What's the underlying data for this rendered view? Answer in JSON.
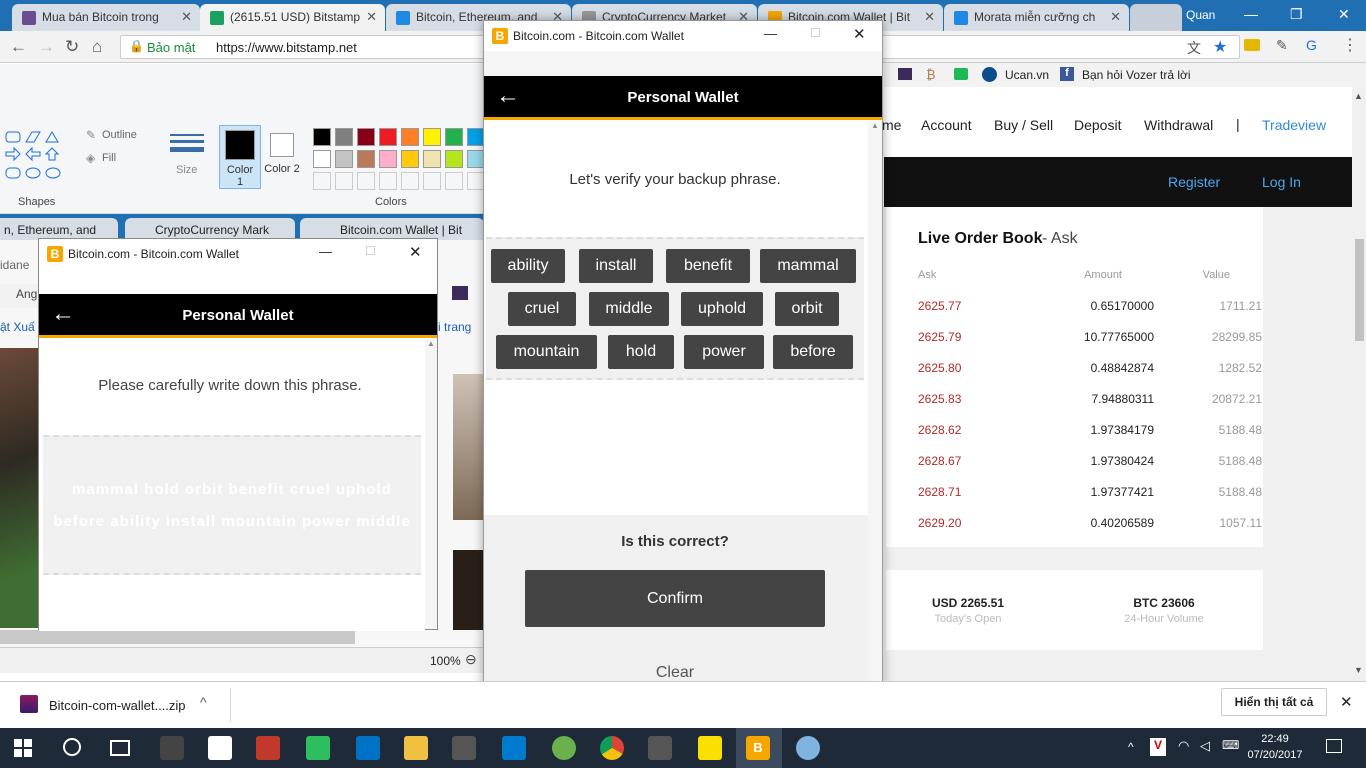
{
  "browser": {
    "tabs": [
      {
        "label": "Mua bán Bitcoin trong",
        "fav": "#6a4c93"
      },
      {
        "label": "(2615.51 USD) Bitstamp",
        "fav": "#1aa260"
      },
      {
        "label": "Bitcoin, Ethereum, and",
        "fav": "#1e88e5"
      },
      {
        "label": "CryptoCurrency Market",
        "fav": "#999999"
      },
      {
        "label": "Bitcoin.com Wallet | Bit",
        "fav": "#f7a600"
      },
      {
        "label": "Morata miễn cưỡng ch",
        "fav": "#1e88e5"
      }
    ],
    "profile": "Quan",
    "secure_label": "Bảo mật",
    "url": "https://www.bitstamp.net",
    "bookmarks": [
      "Ucan.vn",
      "Bạn hỏi Vozer trả lời"
    ]
  },
  "paint": {
    "outline": "Outline",
    "fill": "Fill",
    "shapes": "Shapes",
    "size": "Size",
    "color1": "Color 1",
    "color2": "Color 2",
    "colors": "Colors",
    "zoom": "100%",
    "palette": [
      "#000000",
      "#7f7f7f",
      "#880015",
      "#ed1c24",
      "#ff7f27",
      "#fff200",
      "#22b14c",
      "#00a2e8",
      "#ffffff",
      "#c3c3c3",
      "#b97a57",
      "#ffaec9",
      "#ffc90e",
      "#efe4b0",
      "#b5e61d",
      "#99d9ea"
    ]
  },
  "bg_browser": {
    "tabs": [
      "n, Ethereum, and",
      "CryptoCurrency Mark",
      "Bitcoin.com Wallet | Bit"
    ],
    "left_texts": [
      "idane",
      "Ang",
      "ật Xuấ"
    ],
    "right_text": "i trang"
  },
  "bitstamp": {
    "nav": [
      "me",
      "Account",
      "Buy / Sell",
      "Deposit",
      "Withdrawal",
      "|",
      "Tradeview"
    ],
    "register": "Register",
    "login": "Log In",
    "orderbook_title": "Live Order Book",
    "orderbook_side": "Ask",
    "col_headers": [
      "Ask",
      "Amount",
      "Value"
    ],
    "rows": [
      [
        "2625.77",
        "0.65170000",
        "1711.21"
      ],
      [
        "2625.79",
        "10.77765000",
        "28299.85"
      ],
      [
        "2625.80",
        "0.48842874",
        "1282.52"
      ],
      [
        "2625.83",
        "7.94880311",
        "20872.21"
      ],
      [
        "2628.62",
        "1.97384179",
        "5188.48"
      ],
      [
        "2628.67",
        "1.97380424",
        "5188.48"
      ],
      [
        "2628.71",
        "1.97377421",
        "5188.48"
      ],
      [
        "2629.20",
        "0.40206589",
        "1057.11"
      ]
    ],
    "open_value": "USD 2265.51",
    "open_label": "Today's Open",
    "volume_value": "BTC 23606",
    "volume_label": "24-Hour Volume"
  },
  "wallet_small": {
    "window_title": "Bitcoin.com - Bitcoin.com Wallet",
    "header": "Personal Wallet",
    "instruction": "Please carefully write down this phrase.",
    "phrase_line1": "mammal hold orbit benefit cruel uphold",
    "phrase_line2": "before ability install mountain power middle"
  },
  "wallet_big": {
    "window_title": "Bitcoin.com - Bitcoin.com Wallet",
    "header": "Personal Wallet",
    "instruction": "Let's verify your backup phrase.",
    "words": [
      "ability",
      "install",
      "benefit",
      "mammal",
      "cruel",
      "middle",
      "uphold",
      "orbit",
      "mountain",
      "hold",
      "power",
      "before"
    ],
    "question": "Is this correct?",
    "confirm": "Confirm",
    "clear": "Clear"
  },
  "download": {
    "file": "Bitcoin-com-wallet....zip",
    "show_all": "Hiển thị tất cả"
  },
  "taskbar": {
    "time": "22:49",
    "date": "07/20/2017"
  }
}
